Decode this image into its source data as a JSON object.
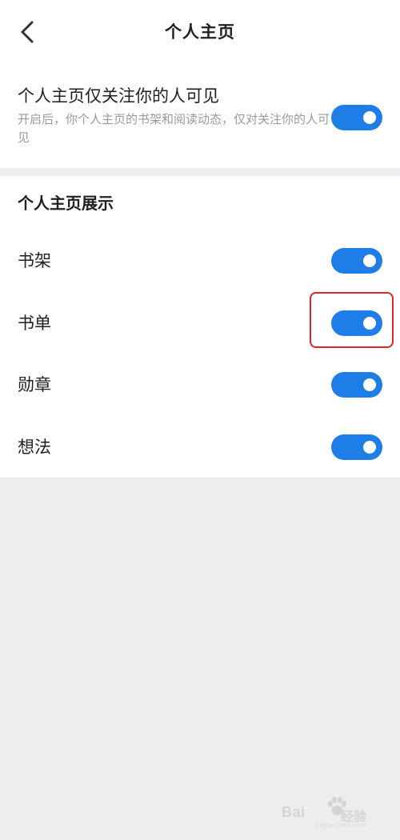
{
  "header": {
    "title": "个人主页",
    "back_icon": "chevron-left-icon"
  },
  "privacy": {
    "title": "个人主页仅关注你的人可见",
    "description": "开启后，你个人主页的书架和阅读动态，仅对关注你的人可见",
    "enabled": true
  },
  "display_section": {
    "title": "个人主页展示",
    "items": [
      {
        "label": "书架",
        "enabled": true
      },
      {
        "label": "书单",
        "enabled": true
      },
      {
        "label": "勋章",
        "enabled": true
      },
      {
        "label": "想法",
        "enabled": true
      }
    ]
  },
  "watermark": {
    "brand": "Bai",
    "sub": "经验",
    "url": "jingyan.baidu.com"
  },
  "colors": {
    "toggle_on": "#1e7de6",
    "highlight": "#d8262b",
    "background": "#ecedef"
  }
}
